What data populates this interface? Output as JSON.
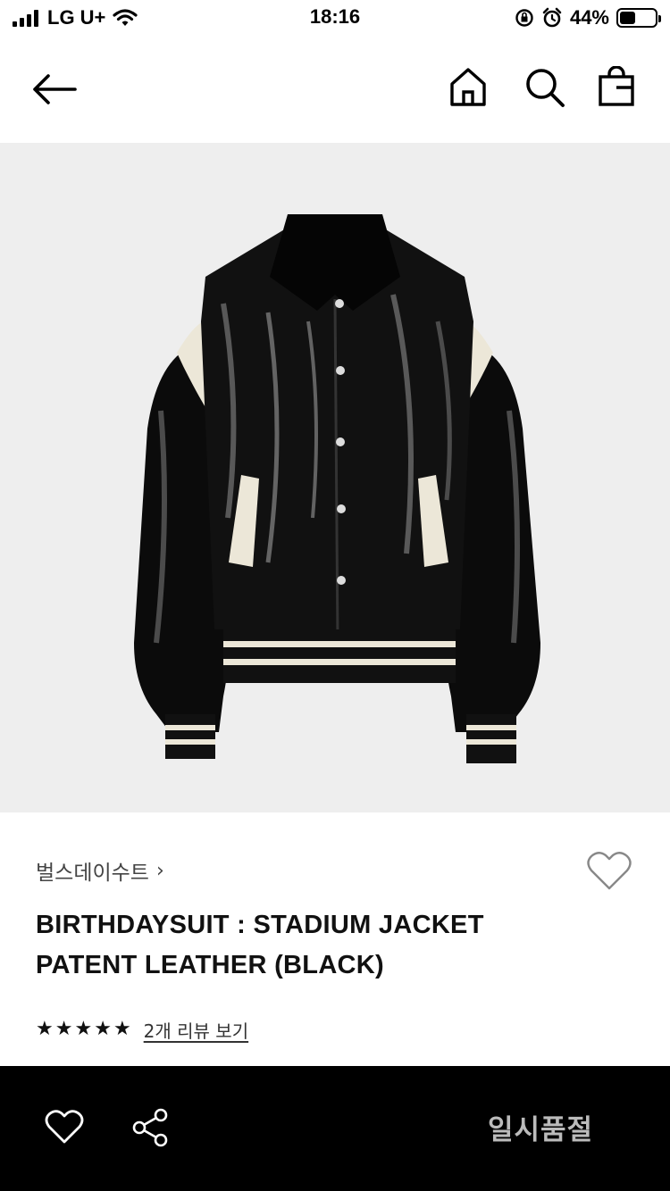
{
  "status_bar": {
    "carrier": "LG U+",
    "time": "18:16",
    "battery_percent": "44%",
    "battery_level": 0.44
  },
  "nav": {
    "back_icon": "arrow-left-icon",
    "home_icon": "home-icon",
    "search_icon": "search-icon",
    "bag_icon": "shopping-bag-icon"
  },
  "product": {
    "image_alt": "stadium-jacket-image",
    "brand": "벌스데이수트",
    "brand_chevron": "›",
    "title_line1": "BIRTHDAYSUIT : STADIUM JACKET",
    "title_line2": "PATENT LEATHER (BLACK)",
    "rating": 5,
    "review_link": "2개 리뷰 보기",
    "wishlist_icon": "heart-outline-icon"
  },
  "bottom_bar": {
    "like_icon": "heart-icon",
    "share_icon": "share-icon",
    "status_label": "일시품절"
  },
  "colors": {
    "image_bg": "#eeeeee",
    "bottom_bg": "#000000",
    "soldout_text": "#bbbbbb"
  }
}
